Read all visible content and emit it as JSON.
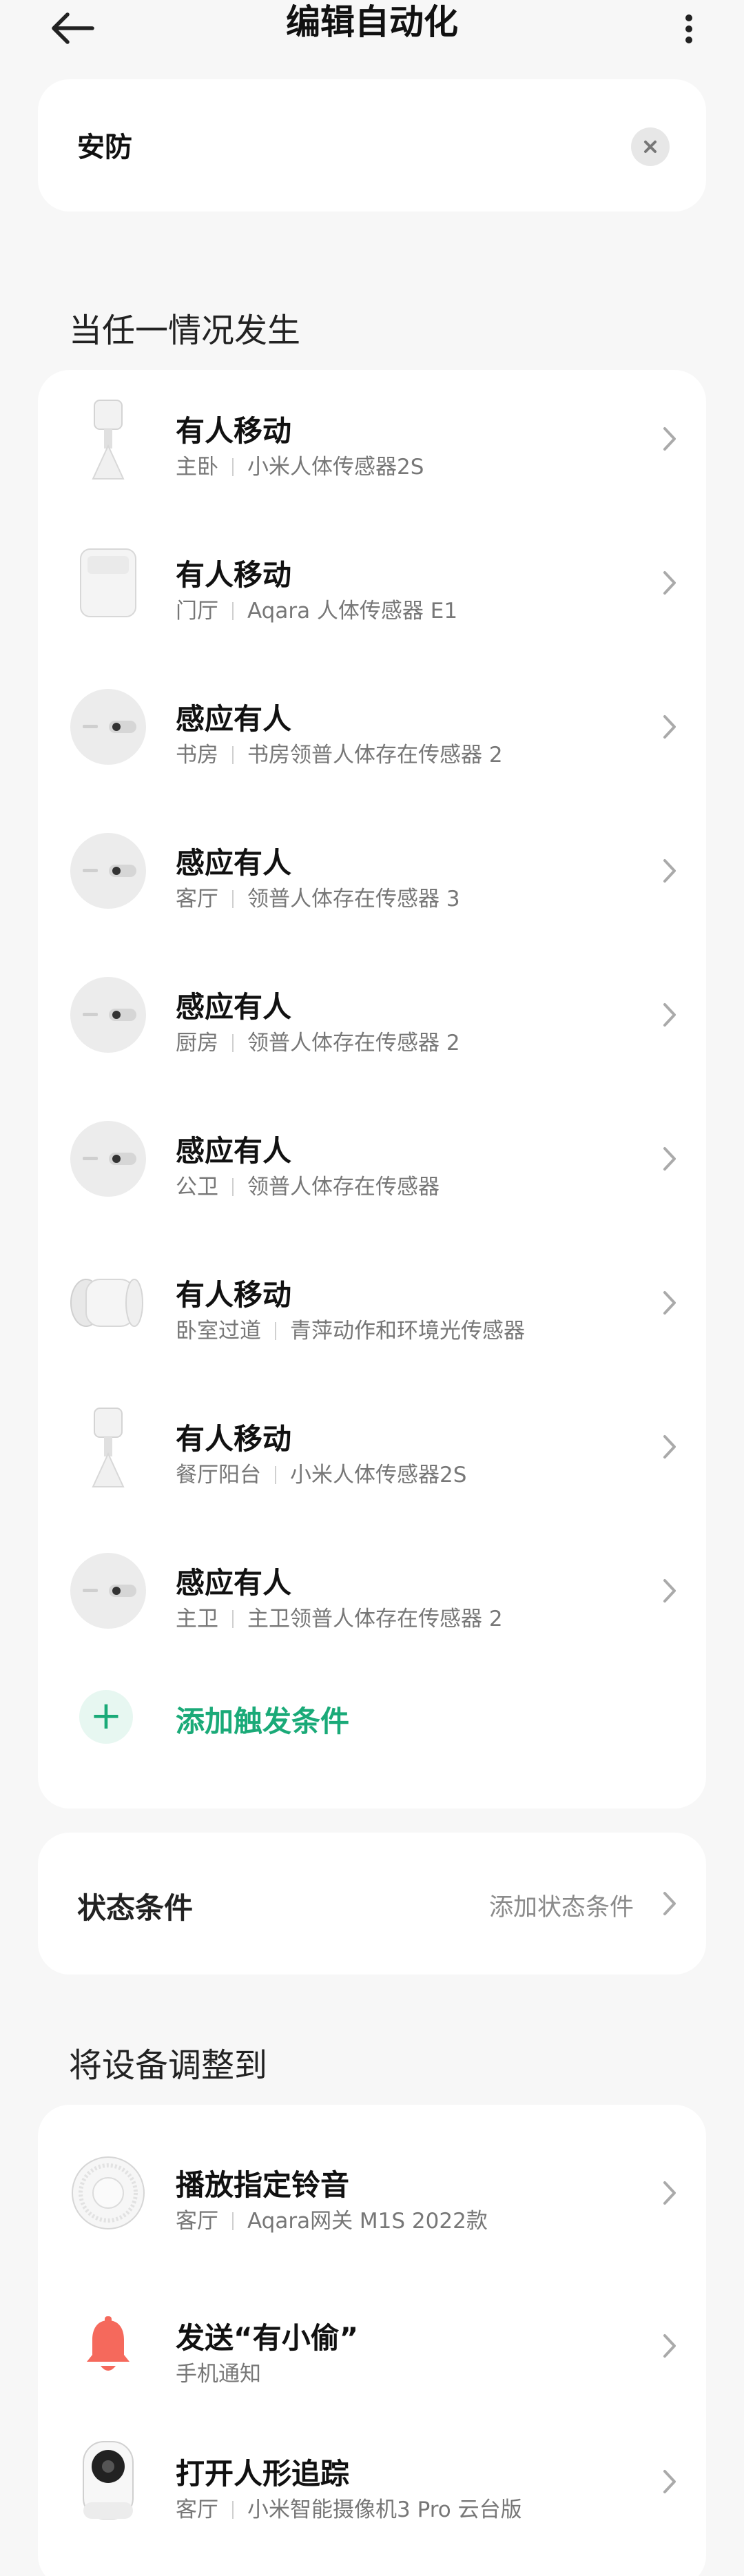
{
  "header": {
    "title": "编辑自动化"
  },
  "scene_name": "安防",
  "trigger_section": {
    "title": "当任一情况发生",
    "items": [
      {
        "title": "有人移动",
        "room": "主卧",
        "device": "小米人体传感器2S",
        "icon": "motion-sensor-2s-icon"
      },
      {
        "title": "有人移动",
        "room": "门厅",
        "device": "Aqara 人体传感器 E1",
        "icon": "aqara-e1-sensor-icon"
      },
      {
        "title": "感应有人",
        "room": "书房",
        "device": "书房领普人体存在传感器 2",
        "icon": "presence-sensor-icon"
      },
      {
        "title": "感应有人",
        "room": "客厅",
        "device": "领普人体存在传感器 3",
        "icon": "presence-sensor-icon"
      },
      {
        "title": "感应有人",
        "room": "厨房",
        "device": "领普人体存在传感器 2",
        "icon": "presence-sensor-icon"
      },
      {
        "title": "感应有人",
        "room": "公卫",
        "device": "领普人体存在传感器",
        "icon": "presence-sensor-icon"
      },
      {
        "title": "有人移动",
        "room": "卧室过道",
        "device": "青萍动作和环境光传感器",
        "icon": "qingping-motion-sensor-icon"
      },
      {
        "title": "有人移动",
        "room": "餐厅阳台",
        "device": "小米人体传感器2S",
        "icon": "motion-sensor-2s-icon"
      },
      {
        "title": "感应有人",
        "room": "主卫",
        "device": "主卫领普人体存在传感器 2",
        "icon": "presence-sensor-icon"
      }
    ],
    "add_label": "添加触发条件"
  },
  "state_section": {
    "title": "状态条件",
    "action": "添加状态条件"
  },
  "action_section": {
    "title": "将设备调整到",
    "items": [
      {
        "title": "播放指定铃音",
        "room": "客厅",
        "device": "Aqara网关 M1S 2022款",
        "icon": "aqara-gateway-icon"
      },
      {
        "title": "发送“有小偷”",
        "subtitle": "手机通知",
        "icon": "bell-icon"
      },
      {
        "title": "打开人形追踪",
        "room": "客厅",
        "device": "小米智能摄像机3 Pro 云台版",
        "icon": "camera-icon"
      }
    ]
  },
  "colors": {
    "accent": "#1aaa78",
    "bell": "#f5695c"
  }
}
